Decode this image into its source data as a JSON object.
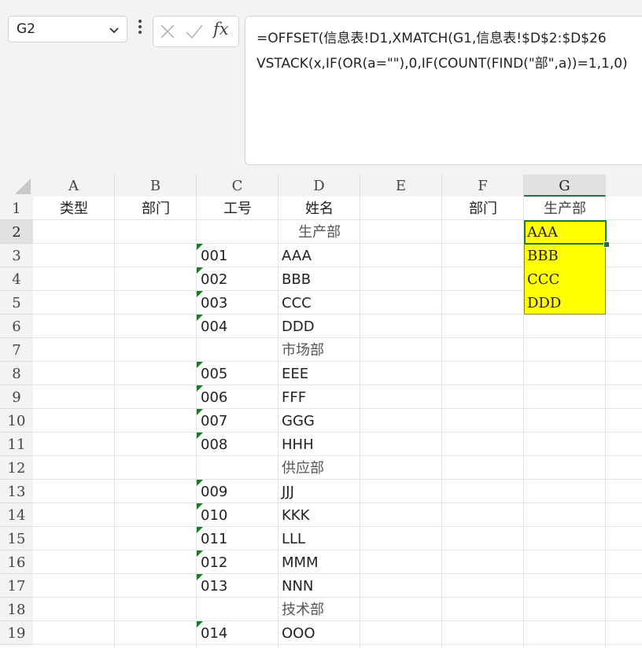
{
  "formula_bar": {
    "name_box": "G2",
    "fx_label": "fx",
    "formula_line1": "=OFFSET(信息表!D1,XMATCH(G1,信息表!$D$2:$D$26",
    "formula_line2": "VSTACK(x,IF(OR(a=\"\"),0,IF(COUNT(FIND(\"部\",a))=1,1,0)"
  },
  "columns": [
    "A",
    "B",
    "C",
    "D",
    "E",
    "F",
    "G"
  ],
  "selected_column": "G",
  "rows": [
    "1",
    "2",
    "3",
    "4",
    "5",
    "6",
    "7",
    "8",
    "9",
    "10",
    "11",
    "12",
    "13",
    "14",
    "15",
    "16",
    "17",
    "18",
    "19"
  ],
  "selected_row": "2",
  "headers": {
    "A1": "类型",
    "B1": "部门",
    "C1": "工号",
    "D1": "姓名",
    "F1": "部门",
    "G1": "生产部"
  },
  "departments": {
    "D2": "生产部",
    "D7": "市场部",
    "D12": "供应部",
    "D18": "技术部"
  },
  "employees": [
    {
      "row": 3,
      "id": "001",
      "name": "AAA"
    },
    {
      "row": 4,
      "id": "002",
      "name": "BBB"
    },
    {
      "row": 5,
      "id": "003",
      "name": "CCC"
    },
    {
      "row": 6,
      "id": "004",
      "name": "DDD"
    },
    {
      "row": 8,
      "id": "005",
      "name": "EEE"
    },
    {
      "row": 9,
      "id": "006",
      "name": "FFF"
    },
    {
      "row": 10,
      "id": "007",
      "name": "GGG"
    },
    {
      "row": 11,
      "id": "008",
      "name": "HHH"
    },
    {
      "row": 13,
      "id": "009",
      "name": "JJJ"
    },
    {
      "row": 14,
      "id": "010",
      "name": "KKK"
    },
    {
      "row": 15,
      "id": "011",
      "name": "LLL"
    },
    {
      "row": 16,
      "id": "012",
      "name": "MMM"
    },
    {
      "row": 17,
      "id": "013",
      "name": "NNN"
    },
    {
      "row": 19,
      "id": "014",
      "name": "OOO"
    }
  ],
  "result": [
    "AAA",
    "BBB",
    "CCC",
    "DDD"
  ],
  "colors": {
    "highlight": "#ffff00",
    "selection": "#217346",
    "number_as_text_flag": "#1e7b25"
  }
}
